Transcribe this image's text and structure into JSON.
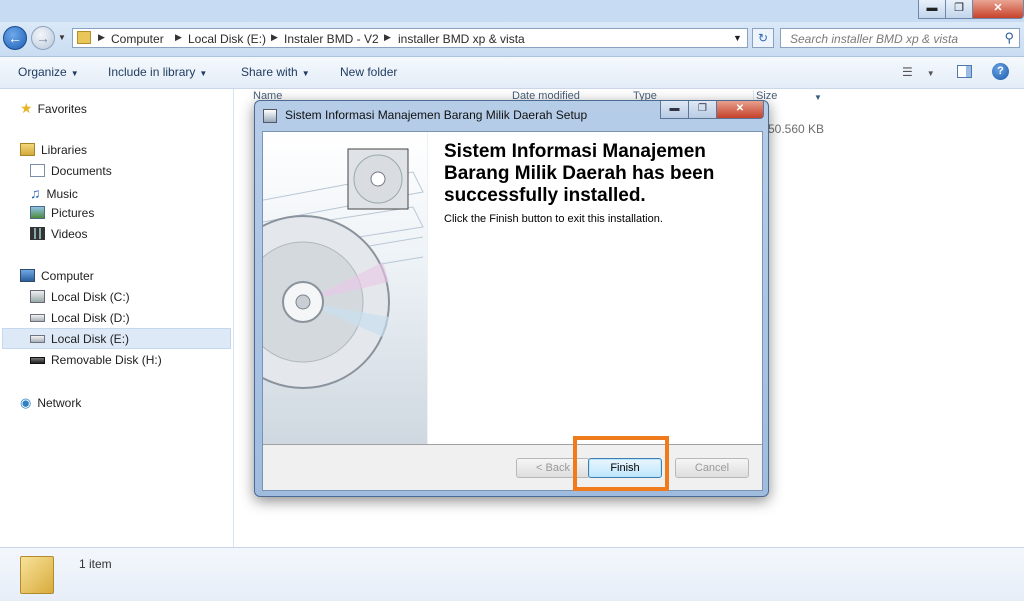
{
  "window": {
    "minimize_label": "▬",
    "maximize_label": "❐",
    "close_label": "✕"
  },
  "address": {
    "breadcrumbs": [
      "Computer",
      "Local Disk (E:)",
      "Instaler BMD - V2",
      "installer BMD xp & vista"
    ],
    "refresh_icon": "refresh-icon"
  },
  "search": {
    "placeholder": "Search installer BMD xp & vista"
  },
  "toolbar": {
    "organize": "Organize",
    "include_in_library": "Include in library",
    "share_with": "Share with",
    "new_folder": "New folder"
  },
  "nav": {
    "favorites": "Favorites",
    "libraries": "Libraries",
    "documents": "Documents",
    "music": "Music",
    "pictures": "Pictures",
    "videos": "Videos",
    "computer": "Computer",
    "drive_c": "Local Disk (C:)",
    "drive_d": "Local Disk (D:)",
    "drive_e": "Local Disk (E:)",
    "drive_h": "Removable Disk (H:)",
    "network": "Network"
  },
  "filelist": {
    "col_name": "Name",
    "col_date": "Date modified",
    "col_type": "Type",
    "col_size": "Size",
    "file_size": "50.560 KB"
  },
  "details": {
    "item_count": "1 item"
  },
  "dialog": {
    "title": "Sistem Informasi Manajemen Barang Milik Daerah Setup",
    "heading": "Sistem Informasi Manajemen Barang Milik Daerah has been successfully installed.",
    "message": "Click the Finish button to exit this installation.",
    "back_label": "< Back",
    "finish_label": "Finish",
    "cancel_label": "Cancel"
  },
  "colors": {
    "highlight": "#f07b1c",
    "selection": "#dde9f6"
  }
}
